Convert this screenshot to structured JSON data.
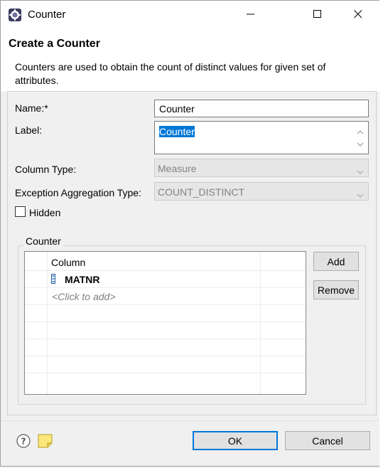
{
  "window": {
    "title": "Counter"
  },
  "dialog": {
    "title": "Create a Counter",
    "description": "Counters are used to obtain the count of distinct values for given set of attributes."
  },
  "form": {
    "name_label": "Name:*",
    "name_value": "Counter",
    "label_label": "Label:",
    "label_value": "Counter",
    "column_type_label": "Column Type:",
    "column_type_value": "Measure",
    "exception_label": "Exception Aggregation Type:",
    "exception_value": "COUNT_DISTINCT",
    "hidden_label": "Hidden",
    "hidden_checked": false
  },
  "counter_group": {
    "label": "Counter",
    "column_header": "Column",
    "rows": [
      {
        "icon": "attribute-column-icon",
        "value": "MATNR"
      }
    ],
    "add_placeholder": "<Click to add>",
    "add_button": "Add",
    "remove_button": "Remove"
  },
  "footer": {
    "ok_button": "OK",
    "cancel_button": "Cancel",
    "help_icon": "help-icon",
    "note_icon": "note-icon"
  },
  "colors": {
    "selection": "#0078d7",
    "ok_border": "#0078d7",
    "disabled_text": "#838383"
  }
}
